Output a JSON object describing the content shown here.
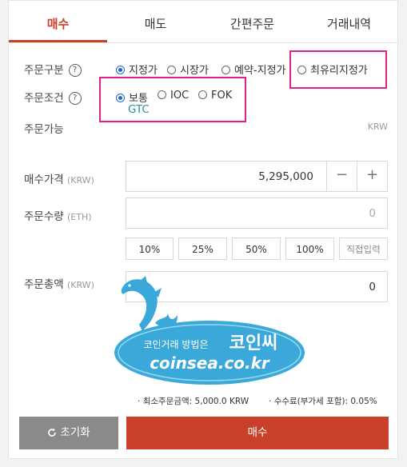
{
  "tabs": [
    {
      "label": "매수",
      "active": true
    },
    {
      "label": "매도"
    },
    {
      "label": "간편주문"
    },
    {
      "label": "거래내역"
    }
  ],
  "order_type": {
    "label": "주문구분",
    "help": "?",
    "options": [
      "지정가",
      "시장가",
      "예약-지정가",
      "최유리지정가"
    ],
    "selected": "지정가"
  },
  "order_condition": {
    "label": "주문조건",
    "help": "?",
    "options": [
      "보통",
      "IOC",
      "FOK"
    ],
    "selected": "보통",
    "sub_label": "GTC"
  },
  "available": {
    "label": "주문가능",
    "unit": "KRW"
  },
  "price": {
    "label": "매수가격",
    "unit": "(KRW)",
    "value": "5,295,000",
    "minus": "−",
    "plus": "+"
  },
  "quantity": {
    "label": "주문수량",
    "unit": "(ETH)",
    "value": "0"
  },
  "pct_buttons": [
    "10%",
    "25%",
    "50%",
    "100%",
    "직접입력"
  ],
  "total": {
    "label": "주문총액",
    "unit": "(KRW)",
    "value": "0"
  },
  "watermark": {
    "brand": "코인씨",
    "prefix": "코인거래 방법은",
    "url": "coinsea.co.kr"
  },
  "fees": {
    "min_order": "최소주문금액: 5,000.0 KRW",
    "fee": "수수료(부가세 포함): 0.05%"
  },
  "buttons": {
    "reset_icon": "refresh-icon",
    "reset": "초기화",
    "buy": "매수"
  },
  "colors": {
    "accent": "#c8402a",
    "radio": "#2266cc",
    "highlight": "#e0208c",
    "gray_button": "#8a8a8a"
  }
}
